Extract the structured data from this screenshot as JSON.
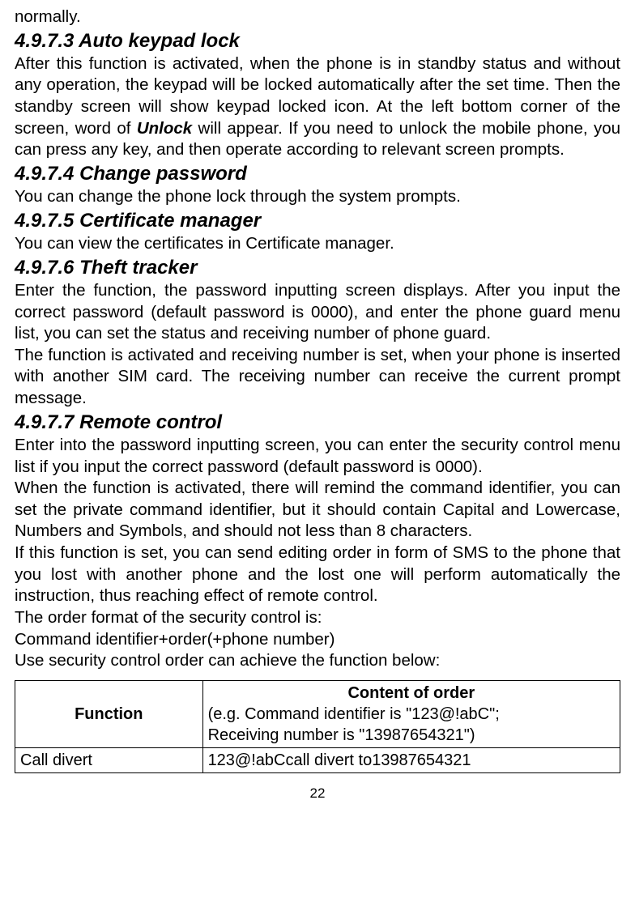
{
  "top_line": "normally.",
  "s1": {
    "title": "4.9.7.3 Auto keypad lock",
    "p1a": "After this function is activated, when the phone is in standby status and without any operation, the keypad will be locked automatically after the set time. Then the standby screen will show keypad locked icon. At the left bottom corner of the screen, word of ",
    "unlock": "Unlock",
    "p1b": " will appear. If you need to unlock the mobile phone, you can press any key, and then operate according to relevant screen prompts."
  },
  "s2": {
    "title": "4.9.7.4 Change password",
    "p": "You can change the phone lock through the system prompts."
  },
  "s3": {
    "title": "4.9.7.5 Certificate manager",
    "p": "You can view the certificates in Certificate manager."
  },
  "s4": {
    "title": "4.9.7.6 Theft tracker",
    "p1": "Enter the function, the password inputting screen displays. After you input the correct password (default password is 0000), and enter the phone guard menu list, you can set the status and receiving number of phone guard.",
    "p2": "The function is activated and receiving number is set, when your phone is inserted with another SIM card. The receiving number can receive the current prompt message."
  },
  "s5": {
    "title": "4.9.7.7 Remote control",
    "p1": "Enter into the password inputting screen, you can enter the security control menu list if you input the correct password (default password is 0000).",
    "p2": "When the function is activated, there will remind the command identifier, you can set the private command identifier, but it should contain Capital and Lowercase, Numbers and Symbols, and should not less than 8 characters.",
    "p3": "If this function is set, you can send editing order in form of SMS to the phone that you lost with another phone and the lost one will perform automatically the instruction, thus reaching effect of remote control.",
    "p4": "The order format of the security control is:",
    "p5": "Command identifier+order(+phone number)",
    "p6": "Use security control order can achieve the function below:"
  },
  "table": {
    "header_left": "Function",
    "header_right_title": "Content of  order",
    "header_right_line2": "(e.g. Command identifier is \"123@!abC\";",
    "header_right_line3": "Receiving number is \"13987654321\")",
    "row1_left": "Call divert",
    "row1_right": "123@!abCcall divert to13987654321"
  },
  "pageno": "22"
}
